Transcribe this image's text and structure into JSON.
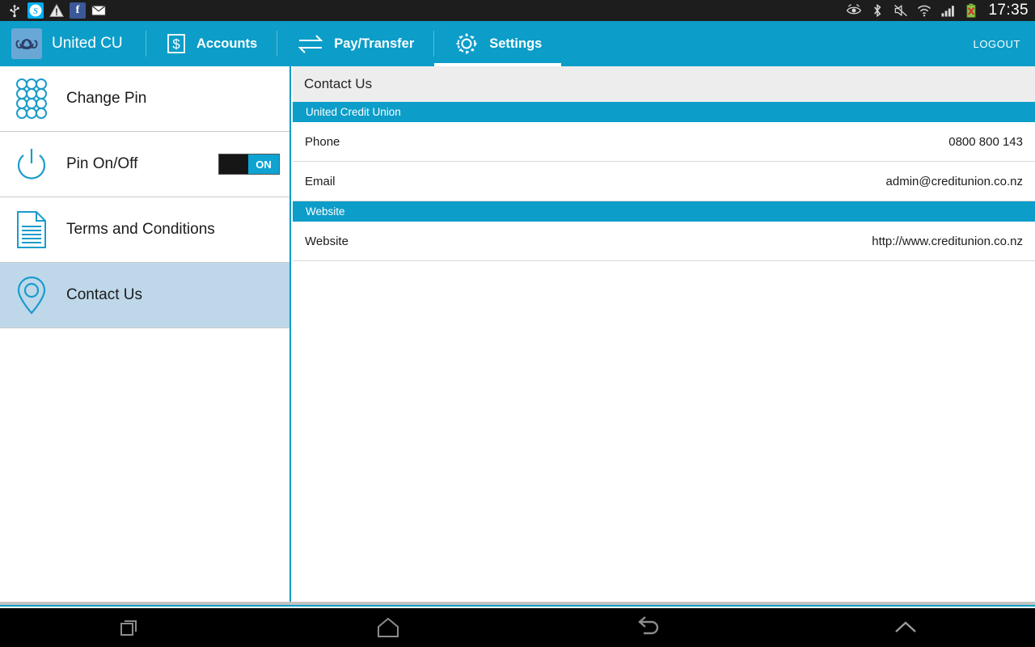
{
  "statusbar": {
    "time": "17:35",
    "left_icons": [
      {
        "name": "usb-icon",
        "glyph": "Ψ"
      },
      {
        "name": "skype-icon",
        "glyph": "S"
      },
      {
        "name": "warning-icon",
        "glyph": "!"
      },
      {
        "name": "facebook-icon",
        "glyph": "f"
      },
      {
        "name": "email-icon",
        "glyph": "✉"
      }
    ],
    "right_icons": [
      {
        "name": "smart-stay-eye-icon"
      },
      {
        "name": "bluetooth-icon"
      },
      {
        "name": "sound-muted-icon"
      },
      {
        "name": "wifi-icon"
      },
      {
        "name": "cellular-signal-icon"
      },
      {
        "name": "battery-icon"
      }
    ]
  },
  "appbar": {
    "brand_title": "United CU",
    "logo_name": "united-cu-logo",
    "nav": [
      {
        "label": "Accounts",
        "icon": "dollar-box-icon",
        "active": false
      },
      {
        "label": "Pay/Transfer",
        "icon": "transfer-arrows-icon",
        "active": false
      },
      {
        "label": "Settings",
        "icon": "gear-icon",
        "active": true
      }
    ],
    "logout_label": "LOGOUT"
  },
  "sidebar": {
    "items": [
      {
        "label": "Change Pin",
        "icon": "keypad-dots-icon",
        "selected": false,
        "toggle": null
      },
      {
        "label": "Pin On/Off",
        "icon": "power-icon",
        "selected": false,
        "toggle": {
          "state": "ON",
          "on": true
        }
      },
      {
        "label": "Terms and Conditions",
        "icon": "document-icon",
        "selected": false,
        "toggle": null
      },
      {
        "label": "Contact Us",
        "icon": "map-pin-icon",
        "selected": true,
        "toggle": null
      }
    ]
  },
  "detail": {
    "title": "Contact Us",
    "sections": [
      {
        "heading": "United Credit Union",
        "rows": [
          {
            "label": "Phone",
            "value": "0800 800 143"
          },
          {
            "label": "Email",
            "value": "admin@creditunion.co.nz"
          }
        ]
      },
      {
        "heading": "Website",
        "rows": [
          {
            "label": "Website",
            "value": "http://www.creditunion.co.nz"
          }
        ]
      }
    ]
  },
  "navbar": {
    "buttons": [
      {
        "name": "recent-apps-button"
      },
      {
        "name": "home-button"
      },
      {
        "name": "back-button"
      },
      {
        "name": "expand-up-button"
      }
    ]
  },
  "colors": {
    "accent": "#0c9dc9",
    "selected_row": "#bed8ea",
    "title_bar": "#ededed",
    "toggle_on": "#0fa3d2"
  }
}
